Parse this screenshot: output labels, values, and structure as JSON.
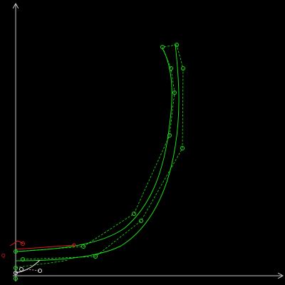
{
  "colors": {
    "background": "#000000",
    "axis": "#c8c8c8",
    "curve_main": "#18e018",
    "control_polygon": "#18e018",
    "control_point": "#18e018",
    "red_accent": "#e01818",
    "white_accent": "#e8e8e8"
  },
  "labels": {
    "red_marker_text": "Q"
  }
}
